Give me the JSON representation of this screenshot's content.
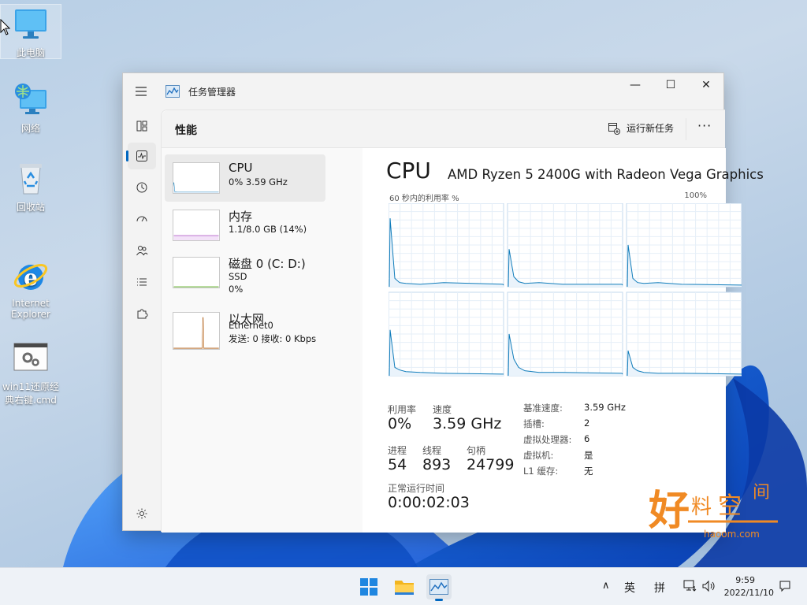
{
  "desktop": {
    "icons": [
      {
        "label": "此电脑"
      },
      {
        "label": "网络"
      },
      {
        "label": "回收站"
      },
      {
        "label": "Internet\nExplorer"
      },
      {
        "label": "win11还原经\n典右键.cmd"
      }
    ]
  },
  "window": {
    "title": "任务管理器",
    "controls": {
      "minimize": "—",
      "maximize": "☐",
      "close": "✕"
    },
    "page_title": "性能",
    "run_task_label": "运行新任务",
    "more_label": "···"
  },
  "resources": [
    {
      "name": "CPU",
      "sub1": "0%  3.59 GHz",
      "sub2": ""
    },
    {
      "name": "内存",
      "sub1": "1.1/8.0 GB (14%)",
      "sub2": ""
    },
    {
      "name": "磁盘 0 (C: D:)",
      "sub1": "SSD",
      "sub2": "0%"
    },
    {
      "name": "以太网",
      "sub1": "Ethernet0",
      "sub2": "发送: 0 接收: 0 Kbps"
    }
  ],
  "cpu": {
    "title": "CPU",
    "model": "AMD Ryzen 5 2400G with Radeon Vega Graphics",
    "graph_label": "60 秒内的利用率 %",
    "graph_max": "100%",
    "stats": {
      "util_label": "利用率",
      "util_value": "0%",
      "speed_label": "速度",
      "speed_value": "3.59 GHz",
      "proc_label": "进程",
      "proc_value": "54",
      "threads_label": "线程",
      "threads_value": "893",
      "handles_label": "句柄",
      "handles_value": "24799",
      "uptime_label": "正常运行时间",
      "uptime_value": "0:00:02:03"
    },
    "info": [
      {
        "label": "基准速度:",
        "value": "3.59 GHz"
      },
      {
        "label": "插槽:",
        "value": "2"
      },
      {
        "label": "虚拟处理器:",
        "value": "6"
      },
      {
        "label": "虚拟机:",
        "value": "是"
      },
      {
        "label": "L1 缓存:",
        "value": "无"
      }
    ]
  },
  "watermark": {
    "main": "好料空间",
    "site": "haoom.com"
  },
  "taskbar": {
    "tray": {
      "chevron": "∧",
      "ime1": "英",
      "ime2": "拼"
    },
    "time": "9:59",
    "date": "2022/11/10"
  },
  "colors": {
    "accent": "#0067c0",
    "graph_line": "#117dbb",
    "memory": "#8b12ae",
    "ethernet": "#a74f01"
  }
}
